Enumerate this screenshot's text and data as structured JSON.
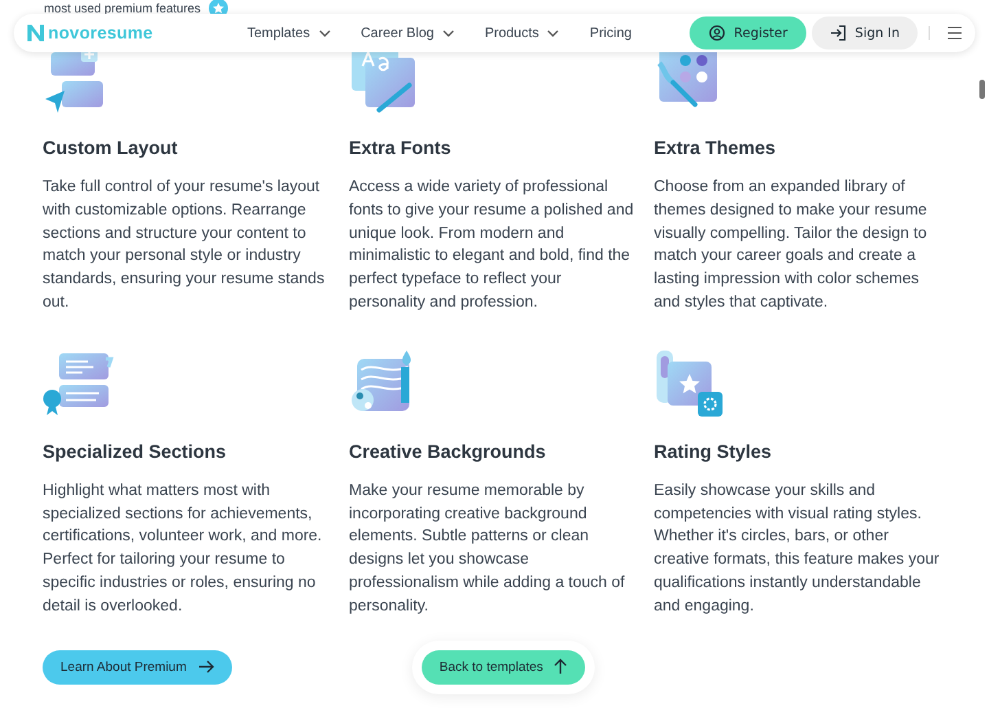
{
  "top_note": {
    "text": "most used premium features"
  },
  "header": {
    "logo": "novoresume",
    "nav": [
      {
        "label": "Templates",
        "dropdown": true
      },
      {
        "label": "Career Blog",
        "dropdown": true
      },
      {
        "label": "Products",
        "dropdown": true
      },
      {
        "label": "Pricing",
        "dropdown": false
      }
    ],
    "register": "Register",
    "sign_in": "Sign In"
  },
  "features": [
    {
      "kind": "layout",
      "title": "Custom Layout",
      "description": "Take full control of your resume's layout with customizable options. Rearrange sections and structure your content to match your personal style or industry standards, ensuring your resume stands out."
    },
    {
      "kind": "fonts",
      "title": "Extra Fonts",
      "description": "Access a wide variety of professional fonts to give your resume a polished and unique look. From modern and minimalistic to elegant and bold, find the perfect typeface to reflect your personality and profession."
    },
    {
      "kind": "themes",
      "title": "Extra Themes",
      "description": "Choose from an expanded library of themes designed to make your resume visually compelling. Tailor the design to match your career goals and create a lasting impression with color schemes and styles that captivate."
    },
    {
      "kind": "sections",
      "title": "Specialized Sections",
      "description": "Highlight what matters most with specialized sections for achievements, certifications, volunteer work, and more. Perfect for tailoring your resume to specific industries or roles, ensuring no detail is overlooked."
    },
    {
      "kind": "backgrounds",
      "title": "Creative Backgrounds",
      "description": "Make your resume memorable by incorporating creative background elements. Subtle patterns or clean designs let you showcase professionalism while adding a touch of personality."
    },
    {
      "kind": "rating",
      "title": "Rating Styles",
      "description": "Easily showcase your skills and competencies with visual rating styles. Whether it's circles, bars, or other creative formats, this feature makes your qualifications instantly understandable and engaging."
    }
  ],
  "buttons": [
    {
      "kind": "premium",
      "label": "Learn About Premium"
    },
    {
      "kind": "back",
      "label": "Back to templates"
    }
  ]
}
